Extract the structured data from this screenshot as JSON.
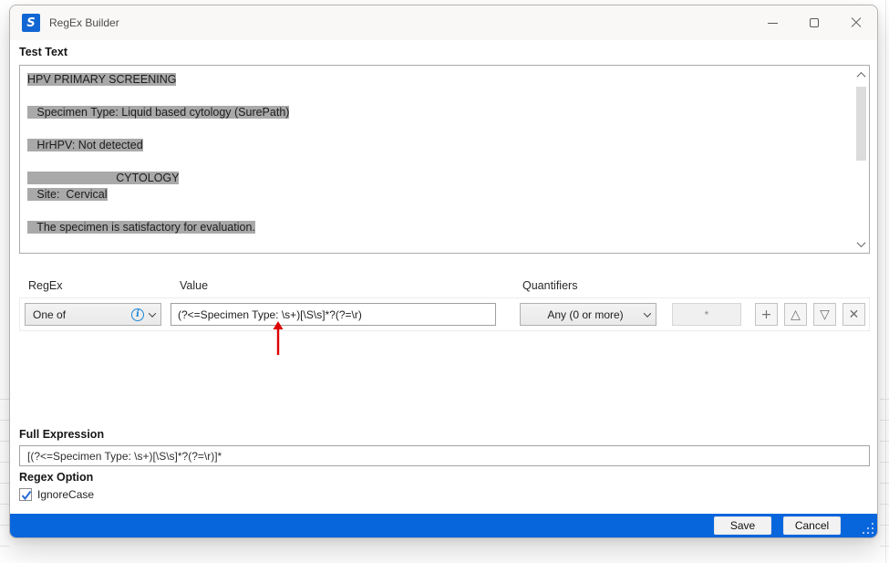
{
  "window": {
    "title": "RegEx Builder",
    "app_icon_letter": "S",
    "accent_color": "#0866DD"
  },
  "icons": {
    "info": "i",
    "add": "+",
    "move_up": "△",
    "move_down": "▽",
    "remove": "✕"
  },
  "test_text": {
    "label": "Test Text",
    "highlight_color": "#a9a9a9",
    "lines": [
      "HPV PRIMARY SCREENING",
      "",
      "   Specimen Type: Liquid based cytology (SurePath)",
      "",
      "   HrHPV: Not detected",
      "",
      "                            CYTOLOGY",
      "   Site:  Cervical",
      "",
      "   The specimen is satisfactory for evaluation."
    ]
  },
  "regex_row": {
    "regex_label": "RegEx",
    "value_label": "Value",
    "quantifiers_label": "Quantifiers",
    "type_selected": "One of",
    "value": "(?<=Specimen Type: \\s+)[\\S\\s]*?(?=\\r)",
    "quantifier_selected": "Any (0 or more)",
    "quantifier_symbol": "*"
  },
  "full_expression": {
    "label": "Full Expression",
    "value": "[(?<=Specimen Type: \\s+)[\\S\\s]*?(?=\\r)]*"
  },
  "regex_option": {
    "label": "Regex Option",
    "checkbox_label": "IgnoreCase",
    "checked": true
  },
  "footer": {
    "save_label": "Save",
    "cancel_label": "Cancel"
  }
}
